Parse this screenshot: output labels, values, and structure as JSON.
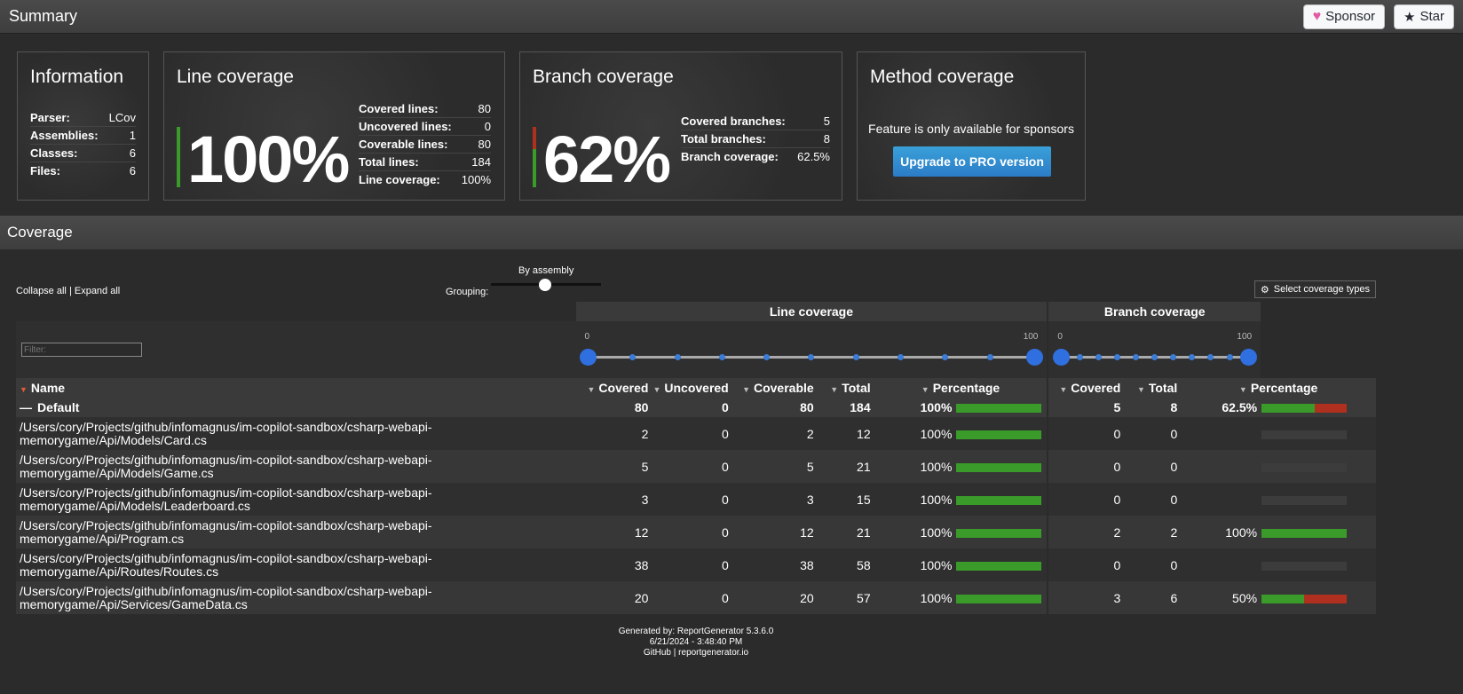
{
  "summary": {
    "title": "Summary",
    "sponsor_label": "Sponsor",
    "star_label": "Star"
  },
  "information": {
    "title": "Information",
    "rows": [
      {
        "k": "Parser:",
        "v": "LCov"
      },
      {
        "k": "Assemblies:",
        "v": "1"
      },
      {
        "k": "Classes:",
        "v": "6"
      },
      {
        "k": "Files:",
        "v": "6"
      }
    ]
  },
  "line_coverage": {
    "title": "Line coverage",
    "percent": "100%",
    "covered_fraction": 1.0,
    "rows": [
      {
        "k": "Covered lines:",
        "v": "80"
      },
      {
        "k": "Uncovered lines:",
        "v": "0"
      },
      {
        "k": "Coverable lines:",
        "v": "80"
      },
      {
        "k": "Total lines:",
        "v": "184"
      },
      {
        "k": "Line coverage:",
        "v": "100%"
      }
    ]
  },
  "branch_coverage": {
    "title": "Branch coverage",
    "percent": "62%",
    "covered_fraction": 0.625,
    "rows": [
      {
        "k": "Covered branches:",
        "v": "5"
      },
      {
        "k": "Total branches:",
        "v": "8"
      },
      {
        "k": "Branch coverage:",
        "v": "62.5%"
      }
    ]
  },
  "method_coverage": {
    "title": "Method coverage",
    "message": "Feature is only available for sponsors",
    "button": "Upgrade to PRO version"
  },
  "coverage": {
    "title": "Coverage",
    "collapse_all": "Collapse all",
    "separator": "|",
    "expand_all": "Expand all",
    "grouping_label": "Grouping:",
    "grouping_value": "By assembly",
    "select_types": "Select coverage types",
    "filter_placeholder": "Filter:",
    "line_group": "Line coverage",
    "branch_group": "Branch coverage",
    "range_min": "0",
    "range_max": "100",
    "headers": {
      "name": "Name",
      "covered": "Covered",
      "uncovered": "Uncovered",
      "coverable": "Coverable",
      "total": "Total",
      "percentage": "Percentage",
      "b_covered": "Covered",
      "b_total": "Total",
      "b_percentage": "Percentage"
    },
    "default_row": {
      "name": "Default",
      "covered": "80",
      "uncovered": "0",
      "coverable": "80",
      "total": "184",
      "pct": "100%",
      "line_frac": 1.0,
      "b_covered": "5",
      "b_total": "8",
      "b_pct": "62.5%",
      "branch_frac": 0.625
    },
    "rows": [
      {
        "name": "/Users/cory/Projects/github/infomagnus/im-copilot-sandbox/csharp-webapi-memorygame/Api/Models/Card.cs",
        "covered": "2",
        "uncovered": "0",
        "coverable": "2",
        "total": "12",
        "pct": "100%",
        "line_frac": 1.0,
        "b_covered": "0",
        "b_total": "0",
        "b_pct": "",
        "branch_frac": null
      },
      {
        "name": "/Users/cory/Projects/github/infomagnus/im-copilot-sandbox/csharp-webapi-memorygame/Api/Models/Game.cs",
        "covered": "5",
        "uncovered": "0",
        "coverable": "5",
        "total": "21",
        "pct": "100%",
        "line_frac": 1.0,
        "b_covered": "0",
        "b_total": "0",
        "b_pct": "",
        "branch_frac": null
      },
      {
        "name": "/Users/cory/Projects/github/infomagnus/im-copilot-sandbox/csharp-webapi-memorygame/Api/Models/Leaderboard.cs",
        "covered": "3",
        "uncovered": "0",
        "coverable": "3",
        "total": "15",
        "pct": "100%",
        "line_frac": 1.0,
        "b_covered": "0",
        "b_total": "0",
        "b_pct": "",
        "branch_frac": null
      },
      {
        "name": "/Users/cory/Projects/github/infomagnus/im-copilot-sandbox/csharp-webapi-memorygame/Api/Program.cs",
        "covered": "12",
        "uncovered": "0",
        "coverable": "12",
        "total": "21",
        "pct": "100%",
        "line_frac": 1.0,
        "b_covered": "2",
        "b_total": "2",
        "b_pct": "100%",
        "branch_frac": 1.0
      },
      {
        "name": "/Users/cory/Projects/github/infomagnus/im-copilot-sandbox/csharp-webapi-memorygame/Api/Routes/Routes.cs",
        "covered": "38",
        "uncovered": "0",
        "coverable": "38",
        "total": "58",
        "pct": "100%",
        "line_frac": 1.0,
        "b_covered": "0",
        "b_total": "0",
        "b_pct": "",
        "branch_frac": null
      },
      {
        "name": "/Users/cory/Projects/github/infomagnus/im-copilot-sandbox/csharp-webapi-memorygame/Api/Services/GameData.cs",
        "covered": "20",
        "uncovered": "0",
        "coverable": "20",
        "total": "57",
        "pct": "100%",
        "line_frac": 1.0,
        "b_covered": "3",
        "b_total": "6",
        "b_pct": "50%",
        "branch_frac": 0.5
      }
    ]
  },
  "footer": {
    "generated": "Generated by: ReportGenerator 5.3.6.0",
    "date": "6/21/2024 - 3:48:40 PM",
    "github": "GitHub",
    "separator": "|",
    "site": "reportgenerator.io"
  },
  "colors": {
    "covered": "#3a9a2a",
    "uncovered": "#b0301f",
    "accent": "#2f6fe0"
  },
  "icons": {
    "sponsor": "heart-icon",
    "star": "star-icon",
    "settings": "gear-icon",
    "sort": "sort-arrow-icon",
    "collapse": "minus-icon"
  }
}
